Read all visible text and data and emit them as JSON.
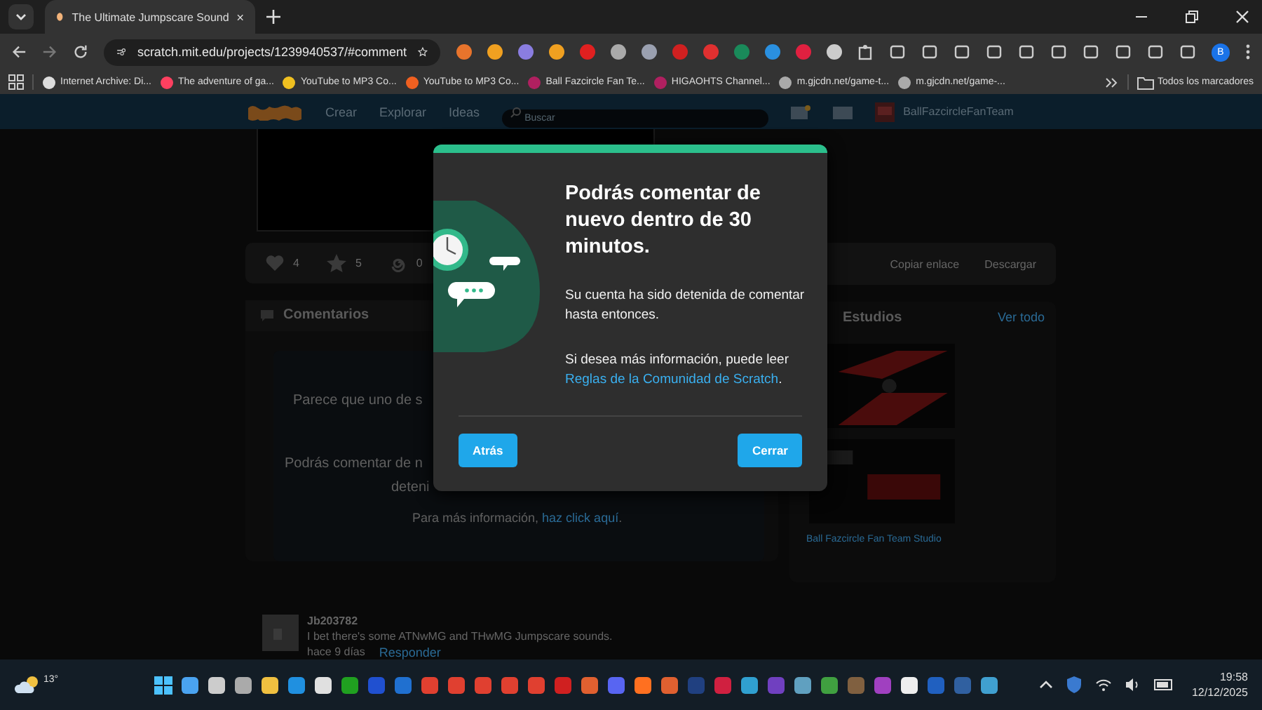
{
  "browser": {
    "tab": {
      "title": "The Ultimate Jumpscare Sound"
    },
    "url": "scratch.mit.edu/projects/1239940537/#comment",
    "profile_initial": "B",
    "bookmarks": [
      "Internet Archive: Di...",
      "The adventure of ga...",
      "YouTube to MP3 Co...",
      "YouTube to MP3 Co...",
      "Ball Fazcircle Fan Te...",
      "HIGAOHTS Channel...",
      "m.gjcdn.net/game-t...",
      "m.gjcdn.net/game-..."
    ],
    "all_bookmarks": "Todos los marcadores"
  },
  "site_nav": {
    "items": [
      "Crear",
      "Explorar",
      "Ideas"
    ],
    "search_placeholder": "Buscar",
    "username": "BallFazcircleFanTeam"
  },
  "project": {
    "stats": [
      {
        "kind": "love",
        "count": "4"
      },
      {
        "kind": "favorite",
        "count": "5"
      },
      {
        "kind": "remix",
        "count": "0"
      }
    ],
    "actions": [
      "Copiar enlace",
      "Descargar"
    ]
  },
  "comments": {
    "heading": "Comentarios",
    "notice_lines": [
      "Parece que uno de s",
      "Podrás comentar de n",
      "deteni"
    ],
    "more_info_text": "Para más información, ",
    "more_info_link": "haz click aquí",
    "more_info_end": ".",
    "items": [
      {
        "author": "Jb203782",
        "text": "I bet there's some ATNwMG and THwMG Jumpscare sounds.",
        "time": "hace 9 días",
        "reply": "Responder"
      }
    ]
  },
  "studios": {
    "heading": "Estudios",
    "view_all": "Ver todo",
    "name": "Ball Fazcircle Fan Team Studio"
  },
  "modal": {
    "title": "Podrás comentar de nuevo dentro de 30 minutos.",
    "body": "Su cuenta ha sido detenida de comentar hasta entonces.",
    "info_text": "Si desea más información, puede leer",
    "info_link": "Reglas de la Comunidad de Scratch",
    "info_end": ".",
    "buttons": [
      "Atrás",
      "Cerrar"
    ]
  },
  "taskbar": {
    "weather": "13°",
    "time": "19:58",
    "date": "12/12/2025"
  }
}
